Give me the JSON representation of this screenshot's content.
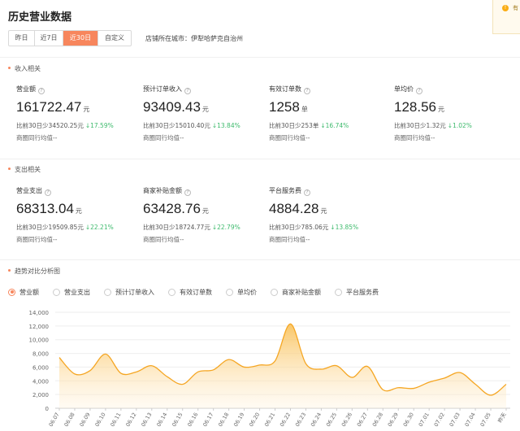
{
  "page": {
    "title": "历史营业数据"
  },
  "date_tabs": [
    {
      "label": "昨日",
      "active": false
    },
    {
      "label": "近7日",
      "active": false
    },
    {
      "label": "近30日",
      "active": true
    },
    {
      "label": "自定义",
      "active": false
    }
  ],
  "store_city": "店铺所在城市：伊犁哈萨克自治州",
  "notice": {
    "text": "有"
  },
  "income": {
    "section_title": "收入相关",
    "metrics": [
      {
        "label": "营业额",
        "value": "161722.47",
        "unit": "元",
        "compare": "比前30日少34520.25元",
        "change": "↓17.59%",
        "district": "商圈同行均值--"
      },
      {
        "label": "预计订单收入",
        "value": "93409.43",
        "unit": "元",
        "compare": "比前30日少15010.40元",
        "change": "↓13.84%",
        "district": "商圈同行均值--"
      },
      {
        "label": "有效订单数",
        "value": "1258",
        "unit": "单",
        "compare": "比前30日少253单",
        "change": "↓16.74%",
        "district": "商圈同行均值--"
      },
      {
        "label": "单均价",
        "value": "128.56",
        "unit": "元",
        "compare": "比前30日少1.32元",
        "change": "↓1.02%",
        "district": "商圈同行均值--"
      }
    ]
  },
  "expense": {
    "section_title": "支出相关",
    "metrics": [
      {
        "label": "营业支出",
        "value": "68313.04",
        "unit": "元",
        "compare": "比前30日少19509.85元",
        "change": "↓22.21%",
        "district": "商圈同行均值--"
      },
      {
        "label": "商家补贴金额",
        "value": "63428.76",
        "unit": "元",
        "compare": "比前30日少18724.77元",
        "change": "↓22.79%",
        "district": "商圈同行均值--"
      },
      {
        "label": "平台服务费",
        "value": "4884.28",
        "unit": "元",
        "compare": "比前30日少785.06元",
        "change": "↓13.85%",
        "district": "商圈同行均值--"
      }
    ]
  },
  "trend": {
    "section_title": "趋势对比分析图",
    "options": [
      {
        "label": "营业额",
        "selected": true
      },
      {
        "label": "营业支出",
        "selected": false
      },
      {
        "label": "预计订单收入",
        "selected": false
      },
      {
        "label": "有效订单数",
        "selected": false
      },
      {
        "label": "单均价",
        "selected": false
      },
      {
        "label": "商家补贴金额",
        "selected": false
      },
      {
        "label": "平台服务费",
        "selected": false
      }
    ]
  },
  "colors": {
    "accent": "#f7865d",
    "line": "#f5a623",
    "fill_top": "#f9c057",
    "down": "#3dba6c"
  },
  "chart_data": {
    "type": "area",
    "title": "",
    "xlabel": "",
    "ylabel": "",
    "ylim": [
      0,
      14000
    ],
    "yticks": [
      "0",
      "2,000",
      "4,000",
      "6,000",
      "8,000",
      "10,000",
      "12,000",
      "14,000"
    ],
    "grid": true,
    "x": [
      "06.07",
      "06.08",
      "06.09",
      "06.10",
      "06.11",
      "06.12",
      "06.13",
      "06.14",
      "06.15",
      "06.16",
      "06.17",
      "06.18",
      "06.19",
      "06.20",
      "06.21",
      "06.22",
      "06.23",
      "06.24",
      "06.25",
      "06.26",
      "06.27",
      "06.28",
      "06.29",
      "06.30",
      "07.01",
      "07.02",
      "07.03",
      "07.04",
      "07.05",
      "昨天"
    ],
    "series": [
      {
        "values": [
          7400,
          5000,
          5500,
          7900,
          5100,
          5300,
          6200,
          4600,
          3500,
          5300,
          5600,
          7100,
          6000,
          6300,
          6900,
          12300,
          6500,
          5700,
          6200,
          4500,
          6100,
          2700,
          3000,
          2900,
          3800,
          4400,
          5200,
          3500,
          1900,
          3500
        ]
      }
    ]
  }
}
